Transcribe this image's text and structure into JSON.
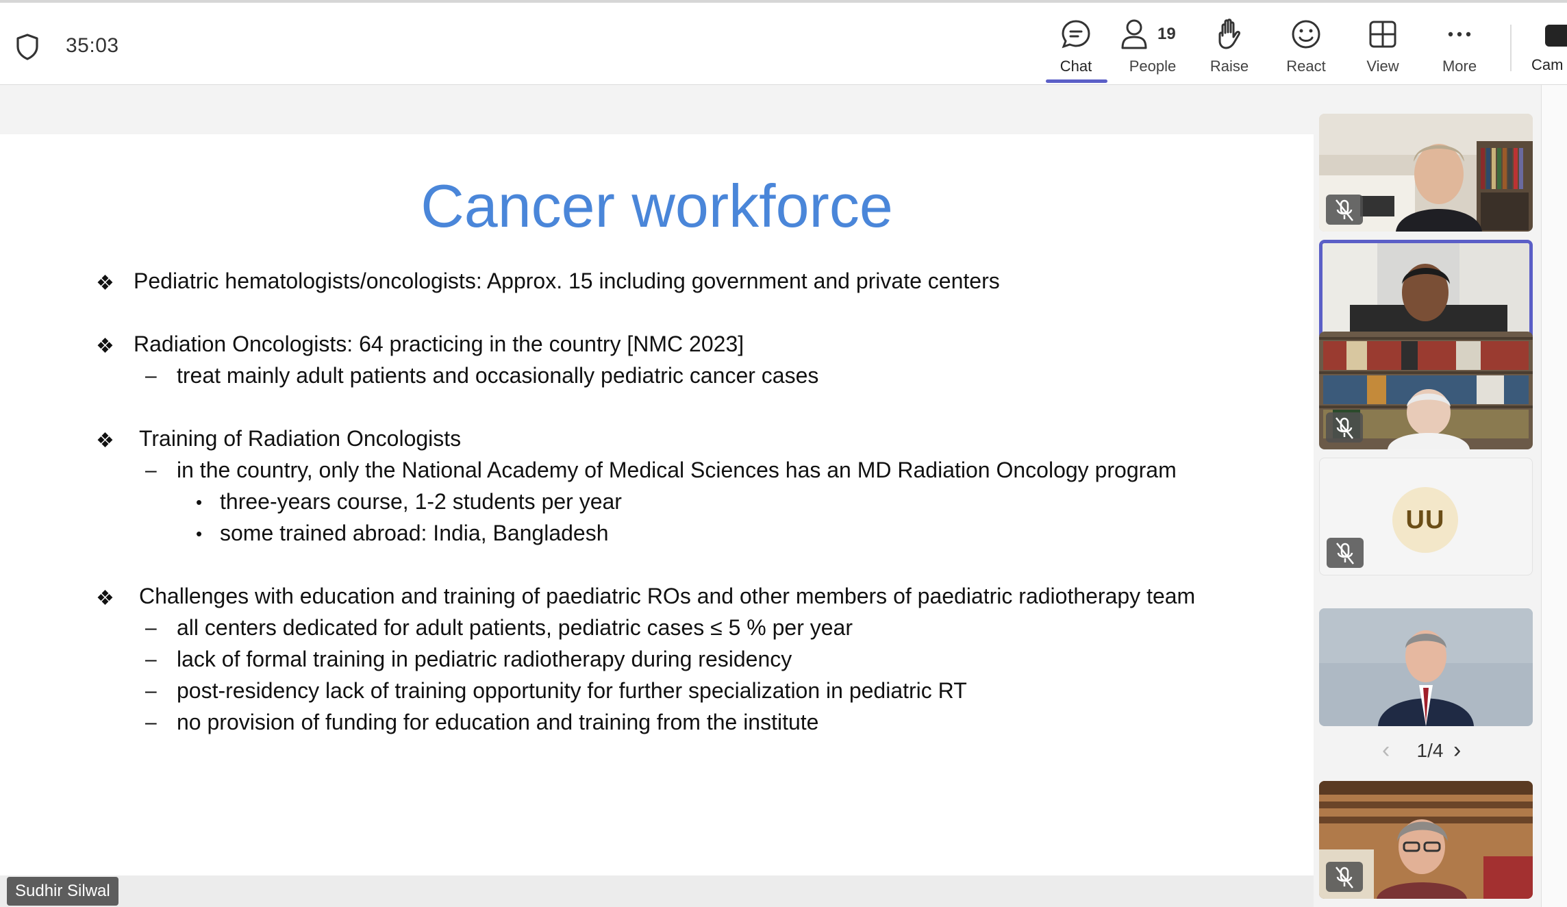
{
  "toolbar": {
    "timer": "35:03",
    "chat_label": "Chat",
    "people_label": "People",
    "people_count": "19",
    "raise_label": "Raise",
    "react_label": "React",
    "view_label": "View",
    "more_label": "More",
    "camera_label": "Cam",
    "active_tab": "Chat",
    "accent_color": "#5b5fc7"
  },
  "slide": {
    "title": "Cancer workforce",
    "title_color": "#4a86d9",
    "b1": "Pediatric hematologists/oncologists: Approx. 15 including government and private centers",
    "b2": "Radiation Oncologists: 64 practicing in the country [NMC 2023]",
    "b2_sub1": "treat mainly adult patients and occasionally pediatric cancer cases",
    "b3": "Training of Radiation Oncologists",
    "b3_sub1": "in the country, only the National Academy of Medical Sciences has an MD Radiation Oncology program",
    "b3_sub1_a": "three-years course, 1-2 students per year",
    "b3_sub1_b": "some trained abroad: India, Bangladesh",
    "b4": "Challenges with education and training of paediatric ROs and other members of paediatric radiotherapy team",
    "b4_sub1": "all centers dedicated for adult patients, pediatric cases ≤ 5 % per year",
    "b4_sub2": "lack of formal training in pediatric radiotherapy during residency",
    "b4_sub3": "post-residency lack of training opportunity for further specialization in pediatric RT",
    "b4_sub4": "no provision of funding for education and training from the institute",
    "bullet_glyph": "❖",
    "dash_glyph": "–",
    "dot_glyph": "•"
  },
  "presenter": {
    "name": "Sudhir Silwal"
  },
  "gallery": {
    "avatar_initials": "UU",
    "page": "1/4",
    "prev_icon": "chevron-left-icon",
    "next_icon": "chevron-right-icon"
  }
}
